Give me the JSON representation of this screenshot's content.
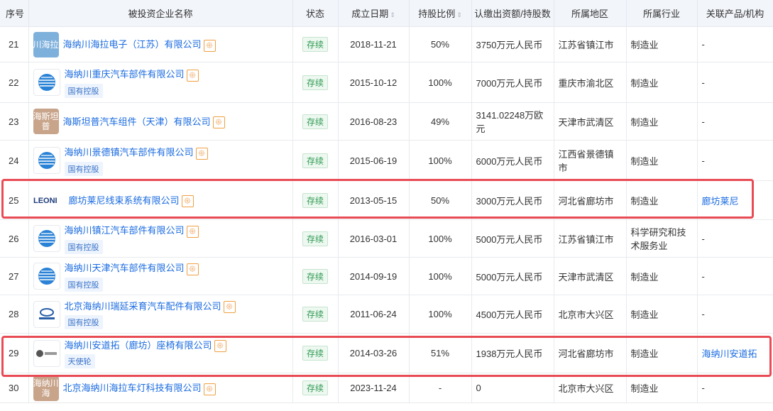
{
  "headers": {
    "idx": "序号",
    "name": "被投资企业名称",
    "status": "状态",
    "date": "成立日期",
    "ratio": "持股比例",
    "capital": "认缴出资额/持股数",
    "region": "所属地区",
    "industry": "所属行业",
    "product": "关联产品/机构"
  },
  "badge_char": "𖤐",
  "rows": [
    {
      "idx": "21",
      "logo": "川海拉",
      "logo_type": "text",
      "logo_color": "#7eb0dc",
      "name": "海纳川海拉电子（江苏）有限公司",
      "tag": "",
      "status": "存续",
      "date": "2018-11-21",
      "ratio": "50%",
      "capital": "3750万元人民币",
      "region": "江苏省镇江市",
      "industry": "制造业",
      "product": "-"
    },
    {
      "idx": "22",
      "logo": "globe",
      "logo_type": "globe",
      "logo_color": "#2a82d6",
      "name": "海纳川重庆汽车部件有限公司",
      "tag": "国有控股",
      "status": "存续",
      "date": "2015-10-12",
      "ratio": "100%",
      "capital": "7000万元人民币",
      "region": "重庆市渝北区",
      "industry": "制造业",
      "product": "-"
    },
    {
      "idx": "23",
      "logo": "海斯坦普",
      "logo_type": "text",
      "logo_color": "#c8a48a",
      "name": "海斯坦普汽车组件（天津）有限公司",
      "tag": "",
      "status": "存续",
      "date": "2016-08-23",
      "ratio": "49%",
      "capital": "3141.02248万欧元",
      "region": "天津市武清区",
      "industry": "制造业",
      "product": "-"
    },
    {
      "idx": "24",
      "logo": "globe",
      "logo_type": "globe",
      "logo_color": "#2a82d6",
      "name": "海纳川景德镇汽车部件有限公司",
      "tag": "国有控股",
      "status": "存续",
      "date": "2015-06-19",
      "ratio": "100%",
      "capital": "6000万元人民币",
      "region": "江西省景德镇市",
      "industry": "制造业",
      "product": "-"
    },
    {
      "idx": "25",
      "logo": "LEONI",
      "logo_type": "leoni",
      "logo_color": "#1b3a7a",
      "name": "廊坊莱尼线束系统有限公司",
      "tag": "",
      "status": "存续",
      "date": "2013-05-15",
      "ratio": "50%",
      "capital": "3000万元人民币",
      "region": "河北省廊坊市",
      "industry": "制造业",
      "product": "廊坊莱尼"
    },
    {
      "idx": "26",
      "logo": "globe",
      "logo_type": "globe",
      "logo_color": "#2a82d6",
      "name": "海纳川镇江汽车部件有限公司",
      "tag": "国有控股",
      "status": "存续",
      "date": "2016-03-01",
      "ratio": "100%",
      "capital": "5000万元人民币",
      "region": "江苏省镇江市",
      "industry": "科学研究和技术服务业",
      "product": "-"
    },
    {
      "idx": "27",
      "logo": "globe",
      "logo_type": "globe",
      "logo_color": "#2a82d6",
      "name": "海纳川天津汽车部件有限公司",
      "tag": "国有控股",
      "status": "存续",
      "date": "2014-09-19",
      "ratio": "100%",
      "capital": "5000万元人民币",
      "region": "天津市武清区",
      "industry": "制造业",
      "product": "-"
    },
    {
      "idx": "28",
      "logo": "car",
      "logo_type": "car",
      "logo_color": "#2a5fa8",
      "name": "北京海纳川瑞延采育汽车配件有限公司",
      "tag": "国有控股",
      "status": "存续",
      "date": "2011-06-24",
      "ratio": "100%",
      "capital": "4500万元人民币",
      "region": "北京市大兴区",
      "industry": "制造业",
      "product": "-"
    },
    {
      "idx": "29",
      "logo": "seat",
      "logo_type": "seat",
      "logo_color": "#555555",
      "name": "海纳川安道拓（廊坊）座椅有限公司",
      "tag": "天使轮",
      "status": "存续",
      "date": "2014-03-26",
      "ratio": "51%",
      "capital": "1938万元人民币",
      "region": "河北省廊坊市",
      "industry": "制造业",
      "product": "海纳川安道拓"
    },
    {
      "idx": "30",
      "logo": "海纳川海",
      "logo_type": "text",
      "logo_color": "#c8a48a",
      "name": "北京海纳川海拉车灯科技有限公司",
      "tag": "",
      "status": "存续",
      "date": "2023-11-24",
      "ratio": "-",
      "capital": "0",
      "region": "北京市大兴区",
      "industry": "制造业",
      "product": "-"
    }
  ]
}
